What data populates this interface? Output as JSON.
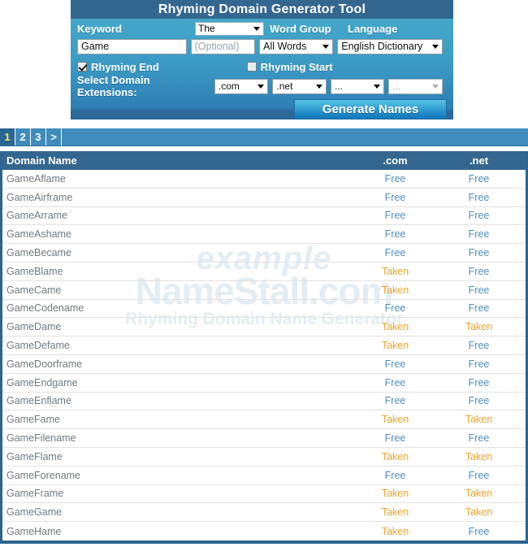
{
  "form": {
    "title": "Rhyming Domain Generator Tool",
    "keyword_label": "Keyword",
    "keyword_value": "Game",
    "the_select_value": "The",
    "optional_placeholder": "(Optional)",
    "word_group_label": "Word Group",
    "word_group_value": "All Words",
    "language_label": "Language",
    "language_value": "English Dictionary",
    "rhyming_end_label": "Rhyming End",
    "rhyming_end_checked": true,
    "rhyming_start_label": "Rhyming Start",
    "rhyming_start_checked": false,
    "extensions_label": "Select Domain Extensions:",
    "ext1": ".com",
    "ext2": ".net",
    "ext3": "...",
    "ext4": "...",
    "generate_label": "Generate Names"
  },
  "pagination": {
    "pages": [
      "1",
      "2",
      "3",
      ">"
    ],
    "active": "1"
  },
  "table": {
    "headers": {
      "name": "Domain Name",
      "com": ".com",
      "net": ".net"
    },
    "rows": [
      {
        "name": "GameAflame",
        "com": "Free",
        "net": "Free"
      },
      {
        "name": "GameAirframe",
        "com": "Free",
        "net": "Free"
      },
      {
        "name": "GameArrame",
        "com": "Free",
        "net": "Free"
      },
      {
        "name": "GameAshame",
        "com": "Free",
        "net": "Free"
      },
      {
        "name": "GameBecame",
        "com": "Free",
        "net": "Free"
      },
      {
        "name": "GameBlame",
        "com": "Taken",
        "net": "Free"
      },
      {
        "name": "GameCame",
        "com": "Taken",
        "net": "Free"
      },
      {
        "name": "GameCodename",
        "com": "Free",
        "net": "Free"
      },
      {
        "name": "GameDame",
        "com": "Taken",
        "net": "Taken"
      },
      {
        "name": "GameDefame",
        "com": "Taken",
        "net": "Free"
      },
      {
        "name": "GameDoorframe",
        "com": "Free",
        "net": "Free"
      },
      {
        "name": "GameEndgame",
        "com": "Free",
        "net": "Free"
      },
      {
        "name": "GameEnflame",
        "com": "Free",
        "net": "Free"
      },
      {
        "name": "GameFame",
        "com": "Taken",
        "net": "Taken"
      },
      {
        "name": "GameFilename",
        "com": "Free",
        "net": "Free"
      },
      {
        "name": "GameFlame",
        "com": "Taken",
        "net": "Taken"
      },
      {
        "name": "GameForename",
        "com": "Free",
        "net": "Free"
      },
      {
        "name": "GameFrame",
        "com": "Taken",
        "net": "Taken"
      },
      {
        "name": "GameGame",
        "com": "Taken",
        "net": "Taken"
      },
      {
        "name": "GameHame",
        "com": "Taken",
        "net": "Free"
      }
    ]
  },
  "watermark": {
    "line1": "example",
    "line2": "NameStall.com",
    "line3": "Rhyming Domain Name Generator"
  },
  "colors": {
    "title_bar": "#34678f",
    "panel": "#3b9ac4",
    "free": "#4f8fc0",
    "taken": "#f0a229",
    "active_page": "#eef35f"
  }
}
